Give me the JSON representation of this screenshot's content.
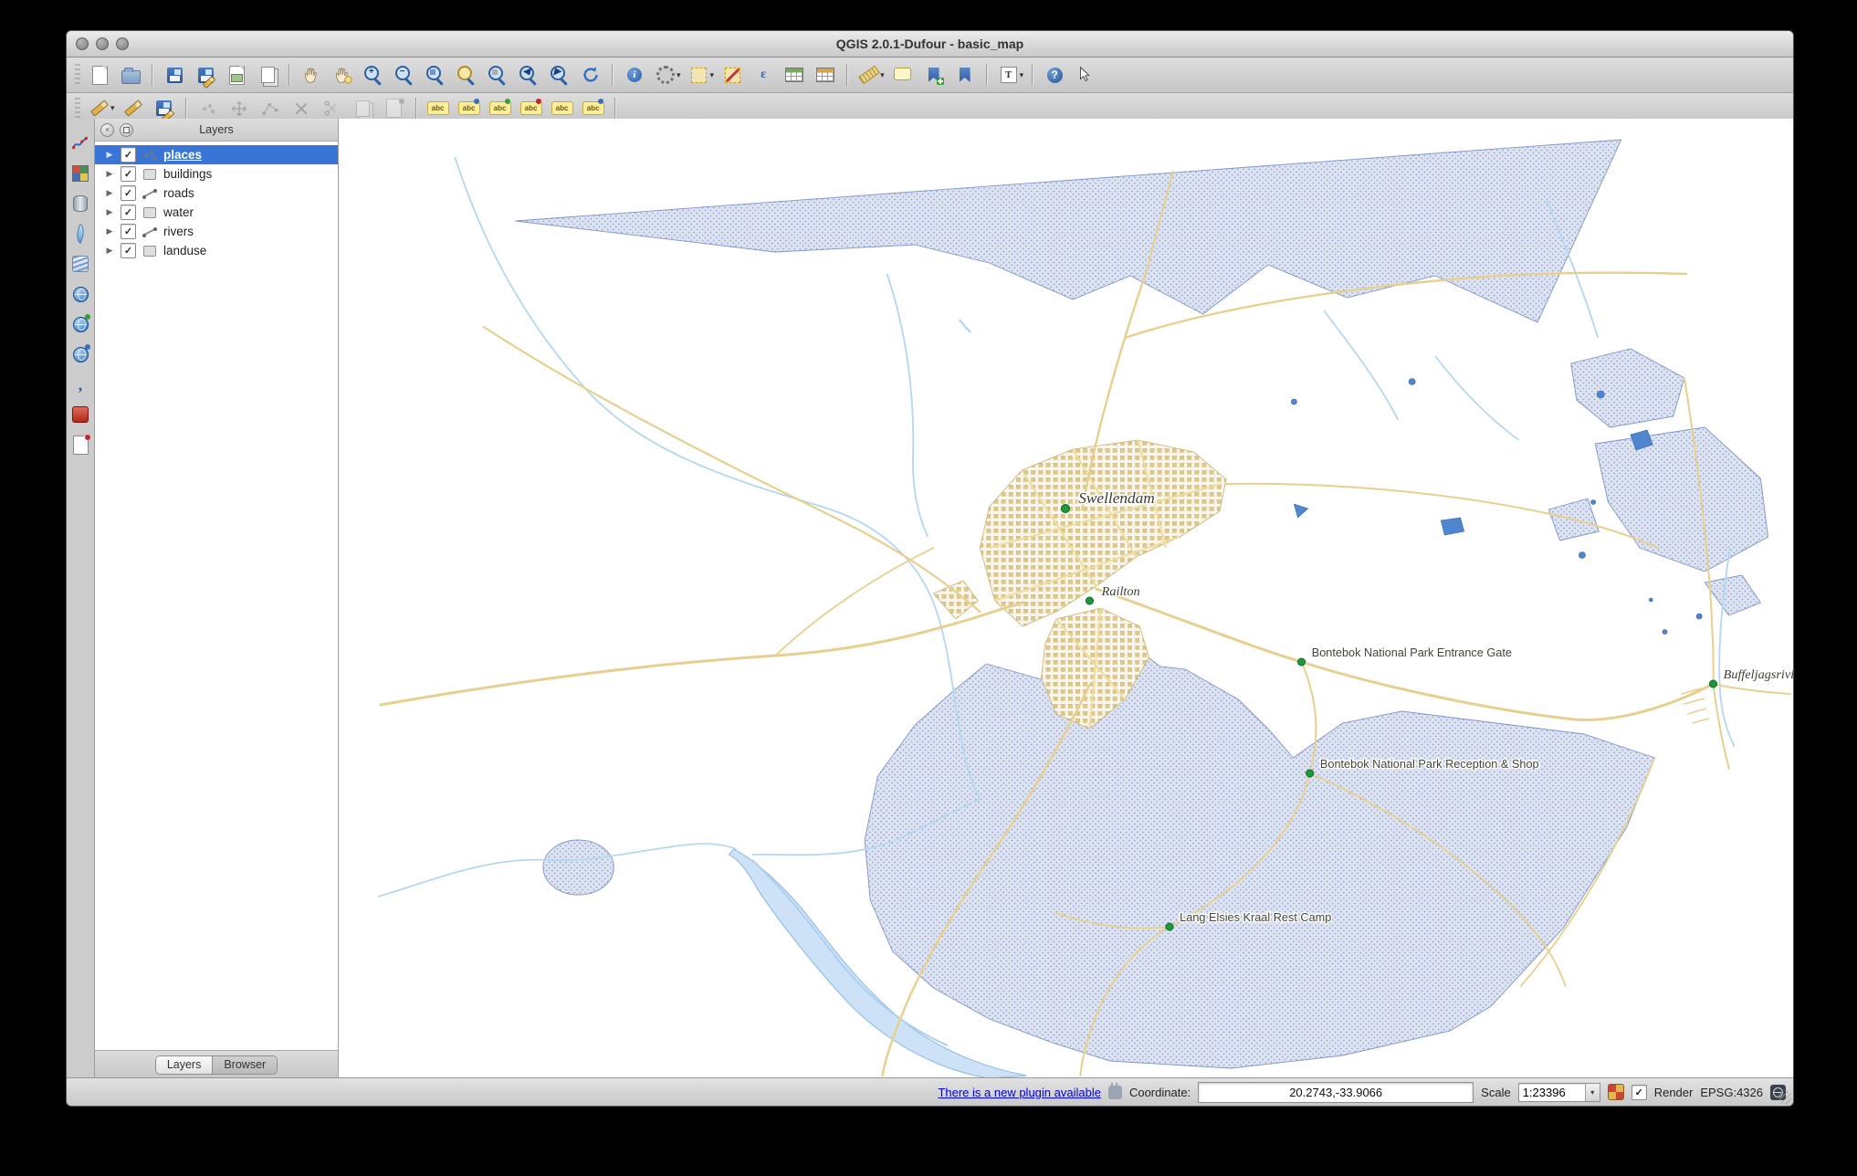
{
  "window": {
    "title": "QGIS 2.0.1-Dufour - basic_map"
  },
  "glyphs": {
    "check": "✓",
    "triangle": "▶",
    "dropdown": "▾",
    "plus": "+",
    "minus": "−",
    "back": "◀",
    "forward": "▶",
    "identify": "i",
    "epsilon": "ε",
    "annotation": "T",
    "help": "?",
    "question": "?",
    "abc": "abc",
    "comma": ",",
    "close": "×"
  },
  "layers_panel": {
    "title": "Layers",
    "items": [
      {
        "label": "places",
        "checked": true,
        "selected": true,
        "geometry": "point"
      },
      {
        "label": "buildings",
        "checked": true,
        "selected": false,
        "geometry": "polygon"
      },
      {
        "label": "roads",
        "checked": true,
        "selected": false,
        "geometry": "line"
      },
      {
        "label": "water",
        "checked": true,
        "selected": false,
        "geometry": "polygon"
      },
      {
        "label": "rivers",
        "checked": true,
        "selected": false,
        "geometry": "line"
      },
      {
        "label": "landuse",
        "checked": true,
        "selected": false,
        "geometry": "polygon"
      }
    ],
    "tabs": [
      {
        "label": "Layers",
        "active": true
      },
      {
        "label": "Browser",
        "active": false
      }
    ]
  },
  "map": {
    "labels": [
      {
        "text": "Swellendam"
      },
      {
        "text": "Railton"
      },
      {
        "text": "Bontebok National Park Entrance Gate"
      },
      {
        "text": "Buffeljagsrivier"
      },
      {
        "text": "Bontebok National Park Reception & Shop"
      },
      {
        "text": "Lang Elsies Kraal Rest Camp"
      }
    ]
  },
  "status_bar": {
    "plugin_link": "There is a new plugin available",
    "coordinate_label": "Coordinate:",
    "coordinate_value": "20.2743,-33.9066",
    "scale_label": "Scale",
    "scale_value": "1:23396",
    "render_label": "Render",
    "crs_label": "EPSG:4326"
  },
  "colors": {
    "selection_blue": "#3875d7",
    "landuse_fill": "#dde3f1",
    "landuse_dot": "#90a3d1",
    "road": "#e7d08f",
    "river": "#b4d7f2",
    "urban_building": "#dec98c",
    "label_dot_green": "#1b9a3d",
    "link_blue": "#0000e0"
  }
}
